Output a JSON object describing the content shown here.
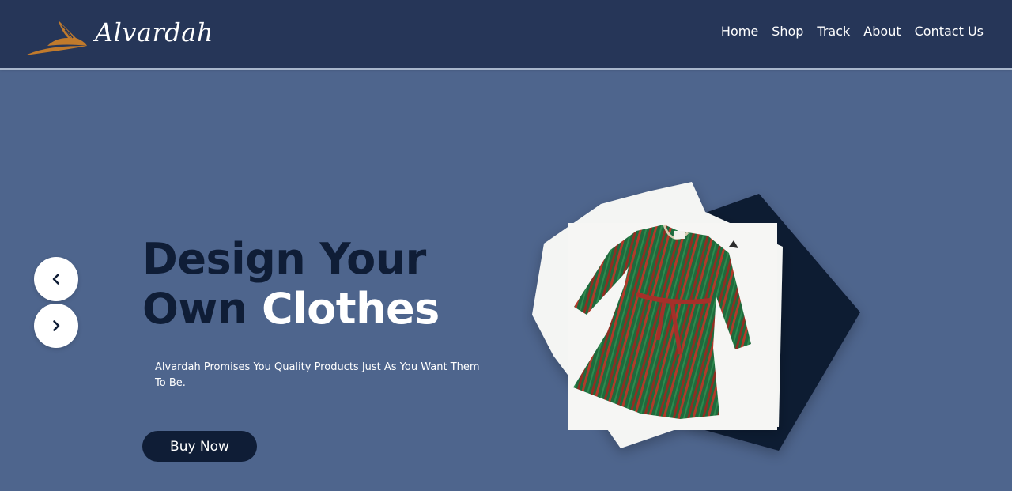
{
  "brand": {
    "name": "Alvardah",
    "logo_icon": "bird-logo-icon",
    "logo_color": "#c07a2c"
  },
  "nav": {
    "items": [
      {
        "label": "Home"
      },
      {
        "label": "Shop"
      },
      {
        "label": "Track"
      },
      {
        "label": "About"
      },
      {
        "label": "Contact Us"
      }
    ]
  },
  "slider": {
    "prev_icon": "chevron-left-icon",
    "next_icon": "chevron-right-icon"
  },
  "hero": {
    "title_line1": "Design Your",
    "title_line2_lead": "Own ",
    "title_line2_accent": "Clothes",
    "subtitle": "Alvardah Promises You Quality Products Just As You Want Them To Be.",
    "cta_label": "Buy Now"
  },
  "product": {
    "image": "striped-dress-image"
  },
  "colors": {
    "header_bg": "#263658",
    "page_bg": "#4e658d",
    "title_dark": "#0f1d36",
    "accent_white": "#ffffff",
    "shape_dark": "#0e1a33",
    "shape_light": "#f4f5f3"
  }
}
